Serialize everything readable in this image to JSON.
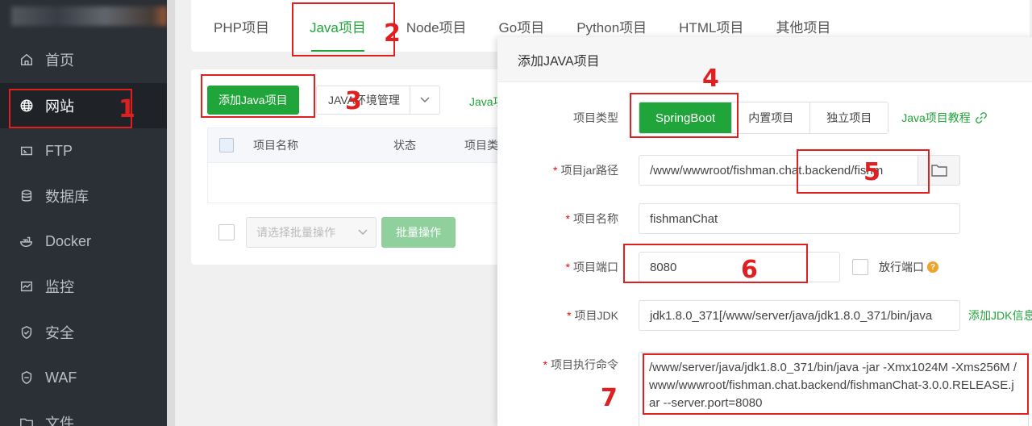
{
  "sidebar": {
    "items": [
      {
        "label": "首页",
        "icon": "home-icon"
      },
      {
        "label": "网站",
        "icon": "globe-icon"
      },
      {
        "label": "FTP",
        "icon": "ftp-icon"
      },
      {
        "label": "数据库",
        "icon": "database-icon"
      },
      {
        "label": "Docker",
        "icon": "docker-icon"
      },
      {
        "label": "监控",
        "icon": "monitor-icon"
      },
      {
        "label": "安全",
        "icon": "shield-icon"
      },
      {
        "label": "WAF",
        "icon": "waf-icon"
      },
      {
        "label": "文件",
        "icon": "folder-icon"
      }
    ],
    "active_index": 1
  },
  "tabs": [
    "PHP项目",
    "Java项目",
    "Node项目",
    "Go项目",
    "Python项目",
    "HTML项目",
    "其他项目"
  ],
  "active_tab": "Java项目",
  "toolbar": {
    "add_button": "添加Java项目",
    "env_button": "JAVA环境管理",
    "java_link": "Java项"
  },
  "table": {
    "headers": [
      "项目名称",
      "状态",
      "项目类"
    ]
  },
  "batch": {
    "select_placeholder": "请选择批量操作",
    "batch_button": "批量操作"
  },
  "dialog": {
    "title": "添加JAVA项目",
    "type_label": "项目类型",
    "types": [
      "SpringBoot",
      "内置项目",
      "独立项目"
    ],
    "active_type": "SpringBoot",
    "tutorial_link": "Java项目教程",
    "jar_label": "项目jar路径",
    "jar_value": "/www/wwwroot/fishman.chat.backend/fishm",
    "name_label": "项目名称",
    "name_value": "fishmanChat",
    "port_label": "项目端口",
    "port_value": "8080",
    "release_port_label": "放行端口",
    "jdk_label": "项目JDK",
    "jdk_value": "jdk1.8.0_371[/www/server/java/jdk1.8.0_371/bin/java",
    "add_jdk_link": "添加JDK信息",
    "cmd_label": "项目执行命令",
    "cmd_value": "/www/server/java/jdk1.8.0_371/bin/java  -jar -Xmx1024M -Xms256M  /www/wwwroot/fishman.chat.backend/fishmanChat-3.0.0.RELEASE.jar --server.port=8080"
  },
  "annotations": [
    "1",
    "2",
    "3",
    "4",
    "5",
    "6",
    "7"
  ],
  "colors": {
    "accent": "#20a53a",
    "annotation": "#e02020",
    "sidebar_bg": "#2b2f36"
  }
}
